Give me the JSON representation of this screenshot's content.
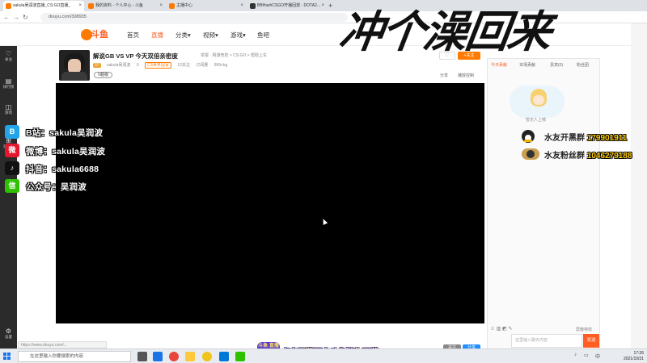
{
  "browser": {
    "tabs": [
      {
        "label": "sakula吴润波直播_CS:GO直播_",
        "icon_color": "#ff7a00"
      },
      {
        "label": "我的资料 - 个人中心 - 斗鱼",
        "icon_color": "#ff7a00"
      },
      {
        "label": "主播中心",
        "icon_color": "#ff7a00"
      },
      {
        "label": "BBHashCSGO开播回放 - DOTA2...",
        "icon_color": "#333333"
      }
    ],
    "new_tab": "+",
    "close_glyph": "×",
    "url": "douyu.com/308935"
  },
  "site": {
    "logo_text": "斗鱼",
    "nav": [
      "首页",
      "直播",
      "分类▾",
      "视频▾",
      "游戏▾",
      "鱼吧"
    ],
    "active_nav_index": 1
  },
  "overlay_title": "冲个澡回来",
  "left_sidebar": [
    {
      "glyph": "♡",
      "label": "关注"
    },
    {
      "glyph": "▤",
      "label": "排行榜"
    },
    {
      "glyph": "◫",
      "label": "游戏"
    },
    {
      "glyph": "⊞",
      "label": "云游戏"
    },
    {
      "glyph": "⚙",
      "label": "设置"
    }
  ],
  "stream": {
    "title": "解说GB VS VP 今天双倍亲密度",
    "subinfo": "举报 · 网游竞技 > CS:GO > 帮助上车",
    "streamer_name": "sakula吴润波",
    "level": "37",
    "fans": "0",
    "tag": "CS世界冠军",
    "stats": [
      "12关注",
      "订阅量",
      "999+kg"
    ],
    "vbadge": "V超级",
    "actions": [
      "分享",
      "播放控制"
    ],
    "follow_label": "+关注",
    "like_glyph": "♡"
  },
  "socials": [
    {
      "platform": "weibo-blue",
      "glyph": "B",
      "color": "#23a3e8",
      "text": "B站：sakula吴润波"
    },
    {
      "platform": "weibo",
      "glyph": "微",
      "color": "#e6162d",
      "text": "微博：sakula吴润波"
    },
    {
      "platform": "douyin",
      "glyph": "♪",
      "color": "#111111",
      "text": "抖音：sakula6688"
    },
    {
      "platform": "wechat",
      "glyph": "信",
      "color": "#2dc100",
      "text": "公众号：吴润波"
    }
  ],
  "chat": {
    "tabs": [
      "今日贡献",
      "本场贡献",
      "贵宾(0)",
      "粉丝团"
    ],
    "mascot_caption": "暂无人上榜",
    "groups": [
      {
        "label": "水友开黑群 ",
        "number": "179901911"
      },
      {
        "label": "水友粉丝群 ",
        "number": "1046279188"
      }
    ],
    "tools": "☺ ▥ ◩ ✎",
    "option": "屏蔽特效",
    "input_placeholder": "这里输入聊天内容",
    "send_label": "发送"
  },
  "bottom": {
    "status_url": "https://www.douyu.com/...",
    "promo_text": "点击屏幕下方斗鱼随你下载",
    "promo_logo": "斗鱼 直播",
    "btn1": "关注",
    "btn2": "分享"
  },
  "taskbar": {
    "search_placeholder": "在这里输入你要搜索的内容",
    "time": "17:26",
    "date": "2021/10/31"
  }
}
